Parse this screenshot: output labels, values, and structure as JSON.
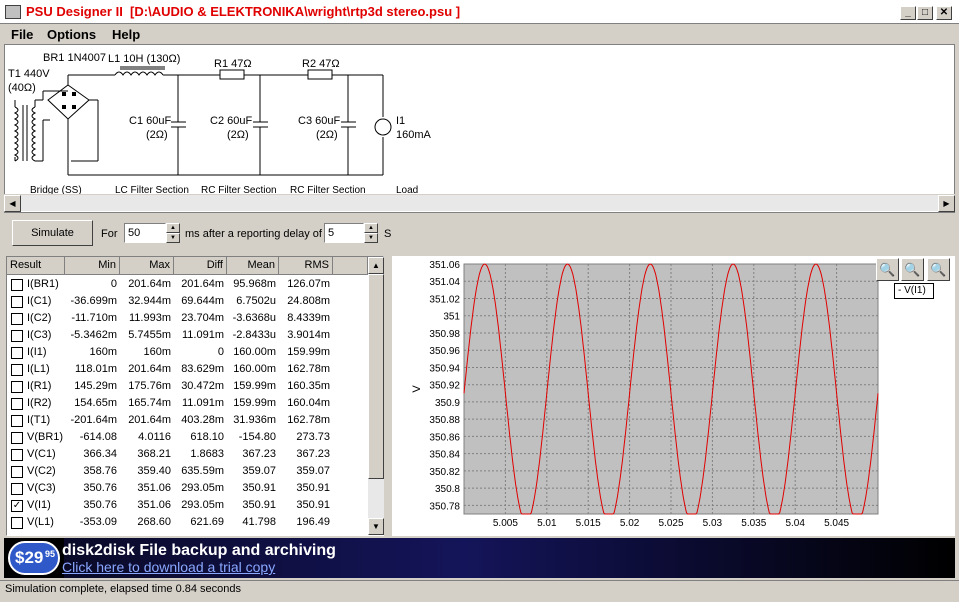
{
  "window": {
    "title": "PSU Designer II  [D:\\AUDIO & ELEKTRONIKA\\wright\\rtp3d stereo.psu ]",
    "minimize": "_",
    "maximize": "□",
    "close": "✕"
  },
  "menu": [
    "File",
    "Options",
    "Help"
  ],
  "schematic": {
    "t1": "T1 440V",
    "t1_r": "(40Ω)",
    "br1": "BR1 1N4007",
    "l1": "L1 10H (130Ω)",
    "r1": "R1 47Ω",
    "r2": "R2 47Ω",
    "c1": "C1 60uF",
    "c1_r": "(2Ω)",
    "c2": "C2 60uF",
    "c2_r": "(2Ω)",
    "c3": "C3 60uF",
    "c3_r": "(2Ω)",
    "i1": "I1",
    "i1_v": "160mA",
    "sections": [
      "Bridge (SS)",
      "LC Filter Section",
      "RC Filter Section",
      "RC Filter Section",
      "Load"
    ]
  },
  "toolbar": {
    "simulate": "Simulate",
    "for_label": "For",
    "for_value": "50",
    "ms_label": "ms  after a reporting delay of",
    "delay_value": "5",
    "s_label": "S"
  },
  "results": {
    "headers": [
      "Result",
      "Min",
      "Max",
      "Diff",
      "Mean",
      "RMS"
    ],
    "rows": [
      {
        "name": "I(BR1)",
        "min": "0",
        "max": "201.64m",
        "diff": "201.64m",
        "mean": "95.968m",
        "rms": "126.07m",
        "checked": false
      },
      {
        "name": "I(C1)",
        "min": "-36.699m",
        "max": "32.944m",
        "diff": "69.644m",
        "mean": "6.7502u",
        "rms": "24.808m",
        "checked": false
      },
      {
        "name": "I(C2)",
        "min": "-11.710m",
        "max": "11.993m",
        "diff": "23.704m",
        "mean": "-3.6368u",
        "rms": "8.4339m",
        "checked": false
      },
      {
        "name": "I(C3)",
        "min": "-5.3462m",
        "max": "5.7455m",
        "diff": "11.091m",
        "mean": "-2.8433u",
        "rms": "3.9014m",
        "checked": false
      },
      {
        "name": "I(I1)",
        "min": "160m",
        "max": "160m",
        "diff": "0",
        "mean": "160.00m",
        "rms": "159.99m",
        "checked": false
      },
      {
        "name": "I(L1)",
        "min": "118.01m",
        "max": "201.64m",
        "diff": "83.629m",
        "mean": "160.00m",
        "rms": "162.78m",
        "checked": false
      },
      {
        "name": "I(R1)",
        "min": "145.29m",
        "max": "175.76m",
        "diff": "30.472m",
        "mean": "159.99m",
        "rms": "160.35m",
        "checked": false
      },
      {
        "name": "I(R2)",
        "min": "154.65m",
        "max": "165.74m",
        "diff": "11.091m",
        "mean": "159.99m",
        "rms": "160.04m",
        "checked": false
      },
      {
        "name": "I(T1)",
        "min": "-201.64m",
        "max": "201.64m",
        "diff": "403.28m",
        "mean": "31.936m",
        "rms": "162.78m",
        "checked": false
      },
      {
        "name": "V(BR1)",
        "min": "-614.08",
        "max": "4.0116",
        "diff": "618.10",
        "mean": "-154.80",
        "rms": "273.73",
        "checked": false
      },
      {
        "name": "V(C1)",
        "min": "366.34",
        "max": "368.21",
        "diff": "1.8683",
        "mean": "367.23",
        "rms": "367.23",
        "checked": false
      },
      {
        "name": "V(C2)",
        "min": "358.76",
        "max": "359.40",
        "diff": "635.59m",
        "mean": "359.07",
        "rms": "359.07",
        "checked": false
      },
      {
        "name": "V(C3)",
        "min": "350.76",
        "max": "351.06",
        "diff": "293.05m",
        "mean": "350.91",
        "rms": "350.91",
        "checked": false
      },
      {
        "name": "V(I1)",
        "min": "350.76",
        "max": "351.06",
        "diff": "293.05m",
        "mean": "350.91",
        "rms": "350.91",
        "checked": true
      },
      {
        "name": "V(L1)",
        "min": "-353.09",
        "max": "268.60",
        "diff": "621.69",
        "mean": "41.798",
        "rms": "196.49",
        "checked": false
      }
    ]
  },
  "chart_data": {
    "type": "line",
    "ylabel": "V",
    "xlim": [
      5.0,
      5.05
    ],
    "ylim": [
      350.77,
      351.06
    ],
    "yticks": [
      "351.06",
      "351.04",
      "351.02",
      "351",
      "350.98",
      "350.96",
      "350.94",
      "350.92",
      "350.9",
      "350.88",
      "350.86",
      "350.84",
      "350.82",
      "350.8",
      "350.78"
    ],
    "xticks": [
      "5.005",
      "5.01",
      "5.015",
      "5.02",
      "5.025",
      "5.03",
      "5.035",
      "5.04",
      "5.045"
    ],
    "series": [
      {
        "name": "V(I1)",
        "color": "#e00000",
        "min": 350.76,
        "max": 351.06,
        "period": 0.01,
        "first_peak": 5.0025
      }
    ],
    "legend": "- V(I1)",
    "grid": true
  },
  "ad": {
    "price": "$29",
    "cents": "95",
    "headline": "disk2disk File backup and archiving",
    "link": "Click here to download a trial copy"
  },
  "status": "Simulation complete, elapsed time 0.84 seconds"
}
